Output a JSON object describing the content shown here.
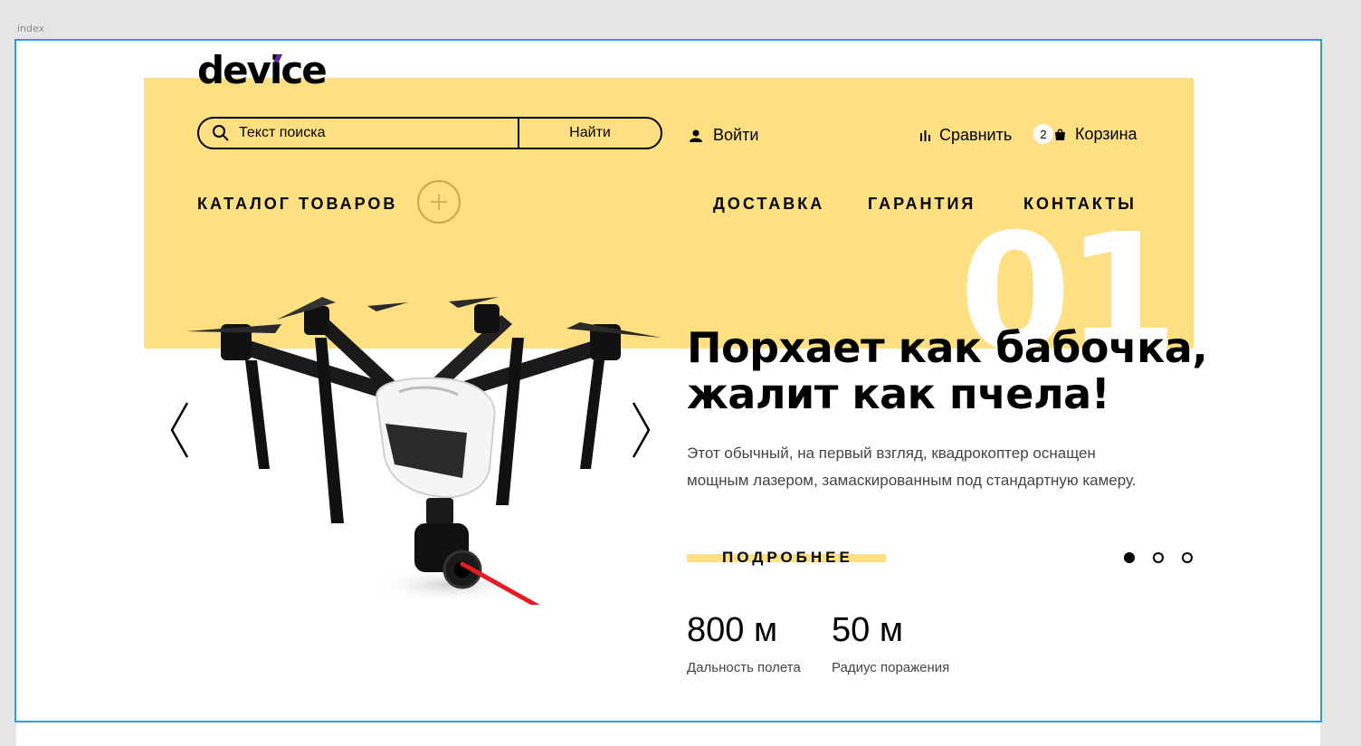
{
  "frame": {
    "label": "index"
  },
  "header": {
    "logo": "device",
    "search": {
      "placeholder": "Текст поиска",
      "button_label": "Найти"
    },
    "login_label": "Войти",
    "compare_label": "Сравнить",
    "cart": {
      "count": "2",
      "label": "Корзина"
    }
  },
  "nav": {
    "catalog_label": "КАТАЛОГ ТОВАРОВ",
    "items": [
      "ДОСТАВКА",
      "ГАРАНТИЯ",
      "КОНТАКТЫ"
    ]
  },
  "slider": {
    "number": "01",
    "title_lines": [
      "Порхает как бабочка,",
      "жалит как пчела!"
    ],
    "description_lines": [
      "Этот обычный, на первый взгляд, квадрокоптер оснащен",
      "мощным лазером, замаскированным под стандартную камеру."
    ],
    "more_label": "ПОДРОБНЕЕ",
    "dots": [
      true,
      false,
      false
    ],
    "stats": [
      {
        "value": "800 м",
        "label": "Дальность полета"
      },
      {
        "value": "50 м",
        "label": "Радиус поражения"
      }
    ]
  },
  "colors": {
    "accent_yellow": "#fedf81",
    "selection_blue": "#2f9ce0",
    "logo_accent": "#5d2a95",
    "laser": "#e51c23"
  },
  "icons": [
    "search-icon",
    "user-icon",
    "compare-icon",
    "cart-icon",
    "plus-icon",
    "arrow-left-icon",
    "arrow-right-icon"
  ]
}
